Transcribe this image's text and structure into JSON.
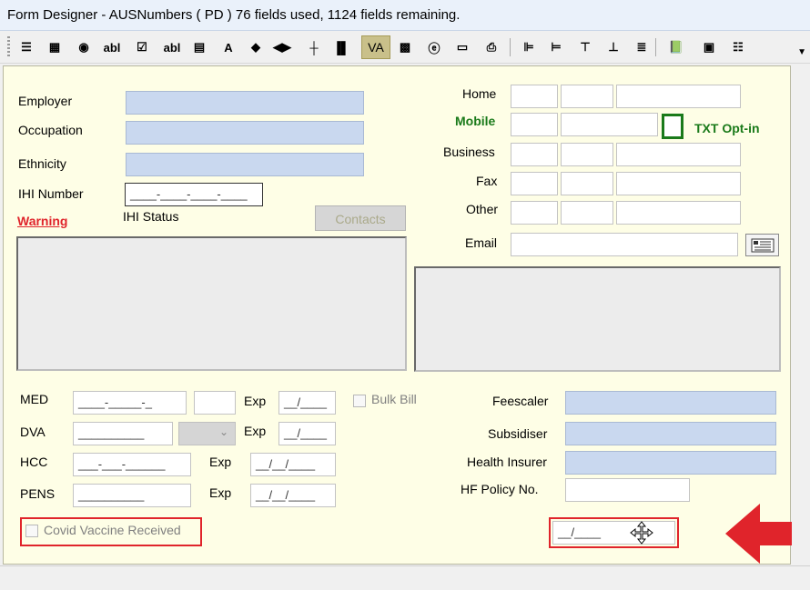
{
  "window": {
    "title": "Form Designer - AUSNumbers ( PD ) 76 fields used, 1124 fields remaining."
  },
  "toolbar": {
    "items": [
      {
        "name": "tab-order-icon",
        "glyph": "☰"
      },
      {
        "name": "grid-icon",
        "glyph": "▦"
      },
      {
        "name": "radio-button-icon",
        "glyph": "◉"
      },
      {
        "name": "textbox-icon",
        "glyph": "abl"
      },
      {
        "name": "checkbox-icon",
        "glyph": "☑"
      },
      {
        "name": "label-icon",
        "glyph": "abl"
      },
      {
        "name": "list-icon",
        "glyph": "▤"
      },
      {
        "name": "font-icon",
        "glyph": "A"
      },
      {
        "name": "shapes-icon",
        "glyph": "◆"
      },
      {
        "name": "arrows-icon",
        "glyph": "◀▶"
      },
      {
        "name": "line-icon",
        "glyph": "┼"
      },
      {
        "name": "chart-icon",
        "glyph": "▐▌"
      },
      {
        "name": "va-button",
        "glyph": "VA"
      },
      {
        "name": "image-icon",
        "glyph": "▩"
      },
      {
        "name": "browser-icon",
        "glyph": "ⓔ"
      },
      {
        "name": "button-icon",
        "glyph": "▭"
      },
      {
        "name": "print-icon",
        "glyph": "⎙"
      },
      {
        "name": "align-left-icon",
        "glyph": "⊫"
      },
      {
        "name": "align-right-icon",
        "glyph": "⊨"
      },
      {
        "name": "align-top-icon",
        "glyph": "⊤"
      },
      {
        "name": "align-bottom-icon",
        "glyph": "⊥"
      },
      {
        "name": "distribute-icon",
        "glyph": "≣"
      },
      {
        "name": "book-icon",
        "glyph": "📗"
      },
      {
        "name": "calendar-icon",
        "glyph": "▣"
      },
      {
        "name": "list-view-icon",
        "glyph": "☷"
      }
    ],
    "colors": {
      "va_bg": "#c9c08a"
    }
  },
  "form": {
    "left": {
      "employer_label": "Employer",
      "occupation_label": "Occupation",
      "ethnicity_label": "Ethnicity",
      "ihi_number_label": "IHI Number",
      "ihi_number_value": "____-____-____-____",
      "warning_label": "Warning",
      "ihi_status_label": "IHI Status",
      "contacts_button": "Contacts"
    },
    "right": {
      "home_label": "Home",
      "mobile_label": "Mobile",
      "txt_optin_label": "TXT Opt-in",
      "business_label": "Business",
      "fax_label": "Fax",
      "other_label": "Other",
      "email_label": "Email"
    },
    "cards": {
      "med_label": "MED",
      "med_value": "____-_____-_",
      "exp_label": "Exp",
      "exp_value_short": "__/____",
      "dva_label": "DVA",
      "dva_value": "__________",
      "hcc_label": "HCC",
      "hcc_value": "___-___-______",
      "exp_value_long": "__/__/____",
      "pens_label": "PENS",
      "pens_value": "__________",
      "bulk_bill_label": "Bulk Bill",
      "covid_label": "Covid Vaccine Received",
      "moved_field_value": "__/____"
    },
    "insurance": {
      "feescaler_label": "Feescaler",
      "subsidiser_label": "Subsidiser",
      "health_insurer_label": "Health Insurer",
      "hf_policy_label": "HF Policy No."
    },
    "colors": {
      "warning": "#e0242b",
      "mobile": "#1a7a1a",
      "optin": "#1a7a1a",
      "highlight_box": "#e0242b",
      "arrow": "#e0242b",
      "blue_field": "#c9d8ef",
      "canvas": "#fefee6"
    }
  }
}
